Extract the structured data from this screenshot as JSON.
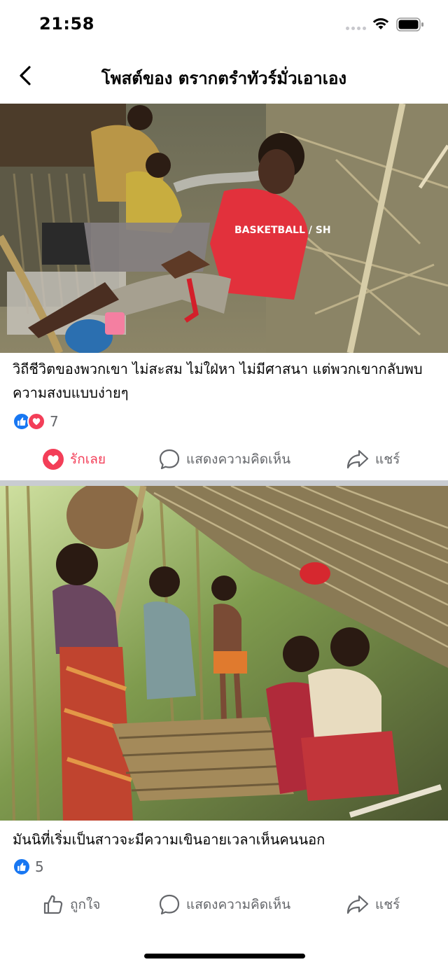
{
  "status_bar": {
    "time": "21:58"
  },
  "header": {
    "title": "โพสต์ของ ตรากตรำทัวร์มั่วเอาเอง"
  },
  "posts": [
    {
      "caption": "วิถีชีวิตของพวกเขา ไม่สะสม ไม่ใฝ่หา ไม่มีศาสนา แต่พวกเขากลับพบความสงบแบบง่ายๆ",
      "reaction_count": "7",
      "reaction_label": "รักเลย",
      "comment_label": "แสดงความคิดเห็น",
      "share_label": "แชร์",
      "shirt_text": "BASKETBALL / SH"
    },
    {
      "caption": "มันนิที่เริ่มเป็นสาวจะมีความเขินอายเวลาเห็นคนนอก",
      "reaction_count": "5",
      "reaction_label": "ถูกใจ",
      "comment_label": "แสดงความคิดเห็น",
      "share_label": "แชร์"
    }
  ],
  "colors": {
    "like": "#1877f2",
    "love": "#f33e58",
    "muted": "#65676b",
    "separator": "#c9ccd1"
  }
}
